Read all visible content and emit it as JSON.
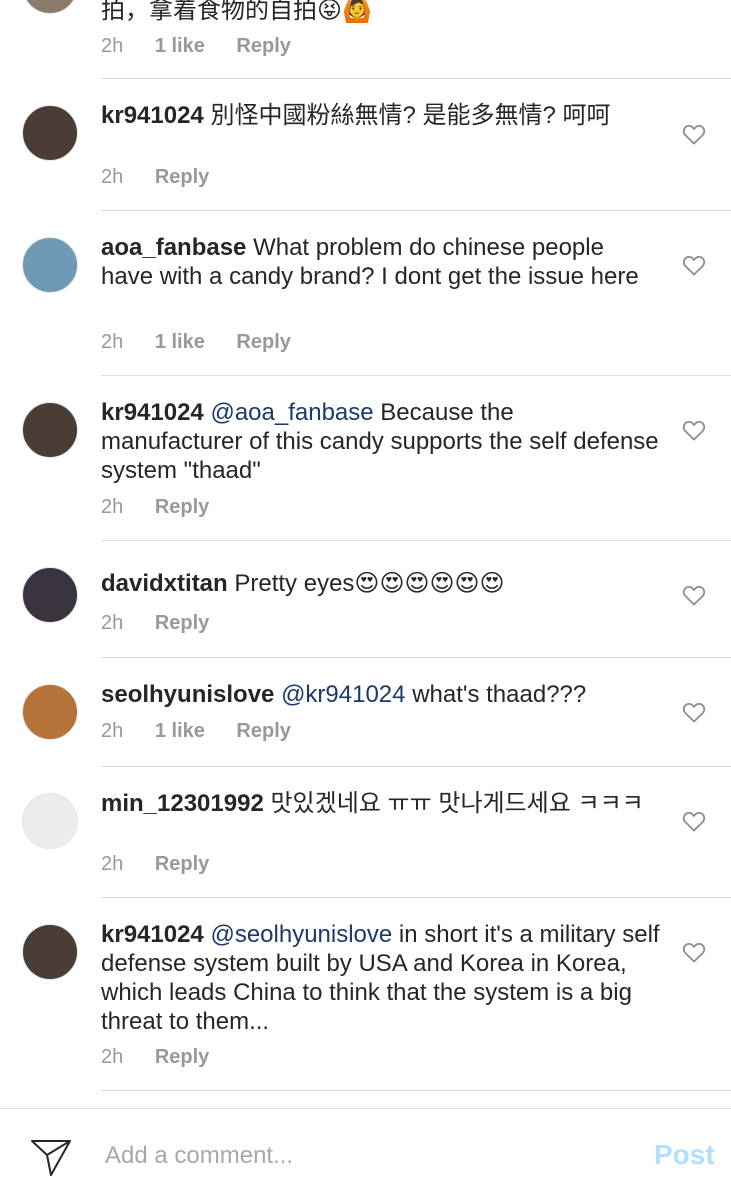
{
  "comments": [
    {
      "username": "",
      "mention": "",
      "text": "拍，拿着食物的自拍😝🙆",
      "time": "2h",
      "likes": "1 like",
      "reply": "Reply",
      "avatar_color": "#8b7b6a"
    },
    {
      "username": "kr941024",
      "mention": "",
      "text": "別怪中國粉絲無情? 是能多無情? 呵呵",
      "time": "2h",
      "likes": "",
      "reply": "Reply",
      "avatar_color": "#4a3d36"
    },
    {
      "username": "aoa_fanbase",
      "mention": "",
      "text": "What problem do chinese people have with a candy brand? I dont get the issue here",
      "time": "2h",
      "likes": "1 like",
      "reply": "Reply",
      "avatar_color": "#6e9ab5"
    },
    {
      "username": "kr941024",
      "mention": "@aoa_fanbase",
      "text": "Because the manufacturer of this candy supports the self defense system \"thaad\"",
      "time": "2h",
      "likes": "",
      "reply": "Reply",
      "avatar_color": "#4a3d36"
    },
    {
      "username": "davidxtitan",
      "mention": "",
      "text": "Pretty eyes😍😍😍😍😍😍",
      "time": "2h",
      "likes": "",
      "reply": "Reply",
      "avatar_color": "#3a3340"
    },
    {
      "username": "seolhyunislove",
      "mention": "@kr941024",
      "text": "what's thaad???",
      "time": "2h",
      "likes": "1 like",
      "reply": "Reply",
      "avatar_color": "#b5733a"
    },
    {
      "username": "min_12301992",
      "mention": "",
      "text": "맛있겠네요 ㅠㅠ 맛나게드세요 ㅋㅋㅋ",
      "time": "2h",
      "likes": "",
      "reply": "Reply",
      "avatar_color": "#e8e8e8"
    },
    {
      "username": "kr941024",
      "mention": "@seolhyunislove",
      "text": "in short it's a military self defense system built by USA and Korea in Korea, which leads China to think that the system is a big threat to them...",
      "time": "2h",
      "likes": "",
      "reply": "Reply",
      "avatar_color": "#4a3d36"
    }
  ],
  "composer": {
    "placeholder": "Add a comment...",
    "post_label": "Post",
    "send_icon": "paper-plane-icon"
  },
  "colors": {
    "username": "#262626",
    "mention": "#1b3a6b",
    "meta": "#999999",
    "post_disabled": "#b2dffc",
    "separator": "#dbdbdb"
  }
}
